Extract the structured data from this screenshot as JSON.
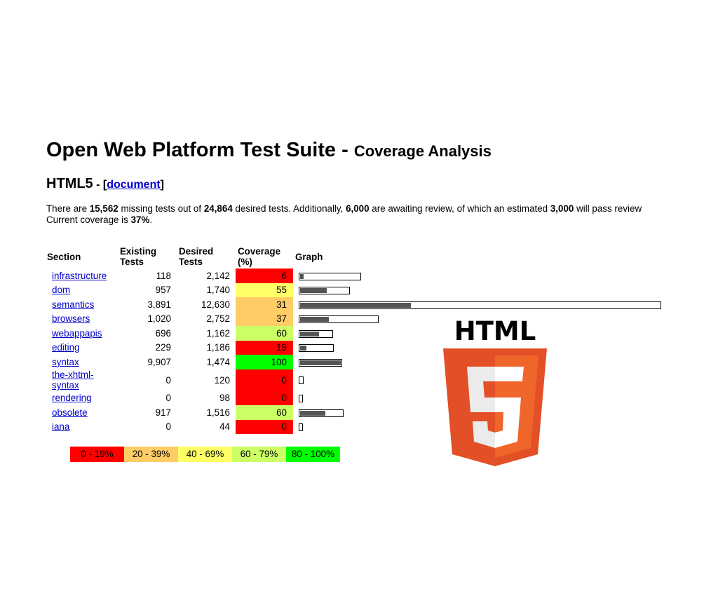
{
  "header": {
    "title": "Open Web Platform Test Suite - ",
    "subtitle": "Coverage Analysis"
  },
  "section_heading": {
    "name": "HTML5",
    "sep": " - [",
    "link": "document",
    "close": "]"
  },
  "summary": {
    "t1": "There are ",
    "missing": "15,562",
    "t2": " missing tests out of ",
    "desired": "24,864",
    "t3": " desired tests. Additionally, ",
    "awaiting": "6,000",
    "t4": " are awaiting review, of which an estimated ",
    "pass": "3,000",
    "t5": " will pass review",
    "t6": "Current coverage is ",
    "coverage": "37%",
    "t7": "."
  },
  "table": {
    "headers": {
      "section": "Section",
      "existing_1": "Existing",
      "existing_2": "Tests",
      "desired_1": "Desired",
      "desired_2": "Tests",
      "coverage_1": "Coverage",
      "coverage_2": "(%)",
      "graph": "Graph"
    },
    "rows": [
      {
        "section": "infrastructure",
        "existing": "118",
        "desired": "2,142",
        "coverage": "6",
        "cov_class": "c-red",
        "desired_n": 2142,
        "existing_n": 118
      },
      {
        "section": "dom",
        "existing": "957",
        "desired": "1,740",
        "coverage": "55",
        "cov_class": "c-yellow",
        "desired_n": 1740,
        "existing_n": 957
      },
      {
        "section": "semantics",
        "existing": "3,891",
        "desired": "12,630",
        "coverage": "31",
        "cov_class": "c-orange",
        "desired_n": 12630,
        "existing_n": 3891
      },
      {
        "section": "browsers",
        "existing": "1,020",
        "desired": "2,752",
        "coverage": "37",
        "cov_class": "c-orange",
        "desired_n": 2752,
        "existing_n": 1020
      },
      {
        "section": "webappapis",
        "existing": "696",
        "desired": "1,162",
        "coverage": "60",
        "cov_class": "c-lgreen",
        "desired_n": 1162,
        "existing_n": 696
      },
      {
        "section": "editing",
        "existing": "229",
        "desired": "1,186",
        "coverage": "19",
        "cov_class": "c-red",
        "desired_n": 1186,
        "existing_n": 229
      },
      {
        "section": "syntax",
        "existing": "9,907",
        "desired": "1,474",
        "coverage": "100",
        "cov_class": "c-green",
        "desired_n": 1474,
        "existing_n": 1474
      },
      {
        "section_1": "the-xhtml-",
        "section_2": "syntax",
        "existing": "0",
        "desired": "120",
        "coverage": "0",
        "cov_class": "c-red",
        "desired_n": 120,
        "existing_n": 0
      },
      {
        "section": "rendering",
        "existing": "0",
        "desired": "98",
        "coverage": "0",
        "cov_class": "c-red",
        "desired_n": 98,
        "existing_n": 0
      },
      {
        "section": "obsolete",
        "existing": "917",
        "desired": "1,516",
        "coverage": "60",
        "cov_class": "c-lgreen",
        "desired_n": 1516,
        "existing_n": 917
      },
      {
        "section": "iana",
        "existing": "0",
        "desired": "44",
        "coverage": "0",
        "cov_class": "c-red",
        "desired_n": 44,
        "existing_n": 0
      }
    ]
  },
  "legend": [
    {
      "label": "0 - 19%",
      "color": "#ff0000"
    },
    {
      "label": "20 - 39%",
      "color": "#ffcc66"
    },
    {
      "label": "40 - 69%",
      "color": "#ffff66"
    },
    {
      "label": "60 - 79%",
      "color": "#ccff66"
    },
    {
      "label": "80 - 100%",
      "color": "#00ff00"
    }
  ],
  "logo": {
    "text": "HTML",
    "digit": "5",
    "colors": {
      "shield": "#e34f26",
      "shield_light": "#ef652a",
      "digit": "#ebebeb",
      "digit_light": "#ffffff"
    }
  }
}
